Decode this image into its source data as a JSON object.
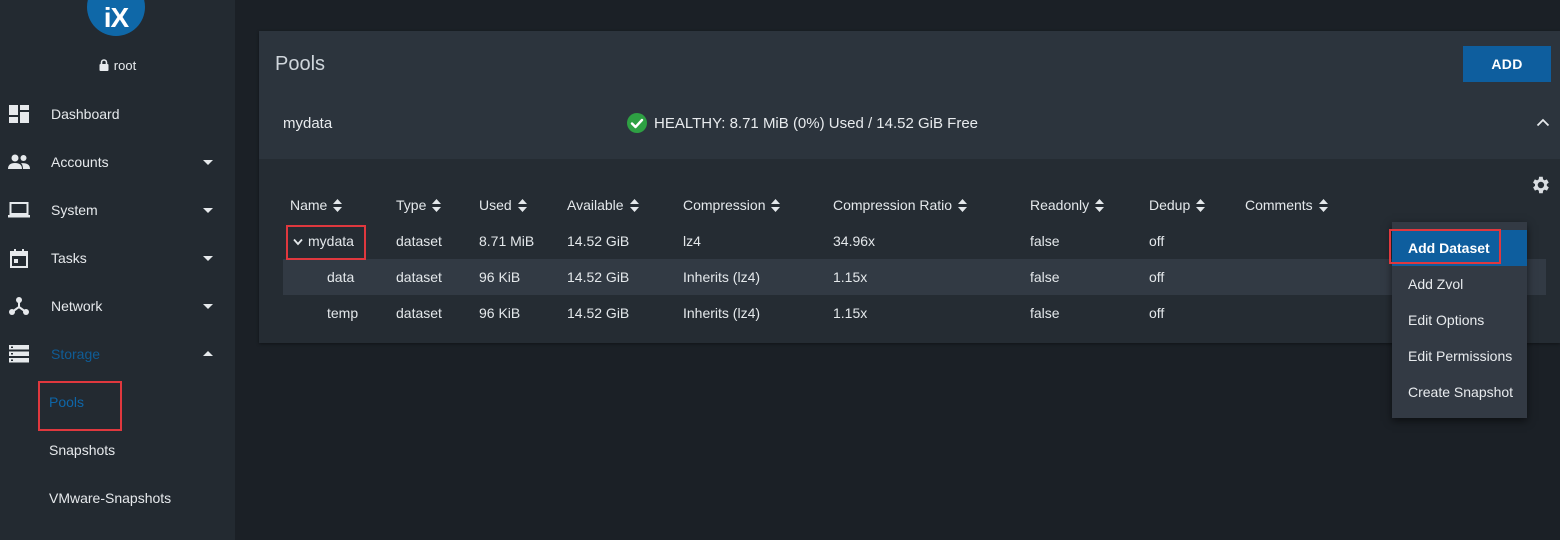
{
  "sidebar": {
    "logo_text": "iX",
    "user": "root",
    "items": [
      {
        "label": "Dashboard",
        "icon": "dashboard-icon",
        "has_caret": false
      },
      {
        "label": "Accounts",
        "icon": "accounts-icon",
        "has_caret": true
      },
      {
        "label": "System",
        "icon": "laptop-icon",
        "has_caret": true
      },
      {
        "label": "Tasks",
        "icon": "calendar-icon",
        "has_caret": true
      },
      {
        "label": "Network",
        "icon": "network-icon",
        "has_caret": true
      },
      {
        "label": "Storage",
        "icon": "storage-icon",
        "has_caret": true,
        "expanded": true
      }
    ],
    "storage_sub": [
      "Pools",
      "Snapshots",
      "VMware-Snapshots"
    ]
  },
  "main": {
    "title": "Pools",
    "add_label": "ADD",
    "pool": {
      "name": "mydata",
      "status": "HEALTHY: 8.71 MiB (0%) Used / 14.52 GiB Free"
    },
    "columns": [
      "Name",
      "Type",
      "Used",
      "Available",
      "Compression",
      "Compression Ratio",
      "Readonly",
      "Dedup",
      "Comments"
    ],
    "rows": [
      {
        "name": "mydata",
        "type": "dataset",
        "used": "8.71 MiB",
        "available": "14.52 GiB",
        "compression": "lz4",
        "ratio": "34.96x",
        "readonly": "false",
        "dedup": "off",
        "comments": ""
      },
      {
        "name": "data",
        "type": "dataset",
        "used": "96 KiB",
        "available": "14.52 GiB",
        "compression": "Inherits (lz4)",
        "ratio": "1.15x",
        "readonly": "false",
        "dedup": "off",
        "comments": ""
      },
      {
        "name": "temp",
        "type": "dataset",
        "used": "96 KiB",
        "available": "14.52 GiB",
        "compression": "Inherits (lz4)",
        "ratio": "1.15x",
        "readonly": "false",
        "dedup": "off",
        "comments": ""
      }
    ]
  },
  "menu": {
    "items": [
      "Add Dataset",
      "Add Zvol",
      "Edit Options",
      "Edit Permissions",
      "Create Snapshot"
    ]
  },
  "colors": {
    "accent": "#0e5e9e",
    "healthy": "#2ea043",
    "highlight_box": "#e0383e"
  }
}
